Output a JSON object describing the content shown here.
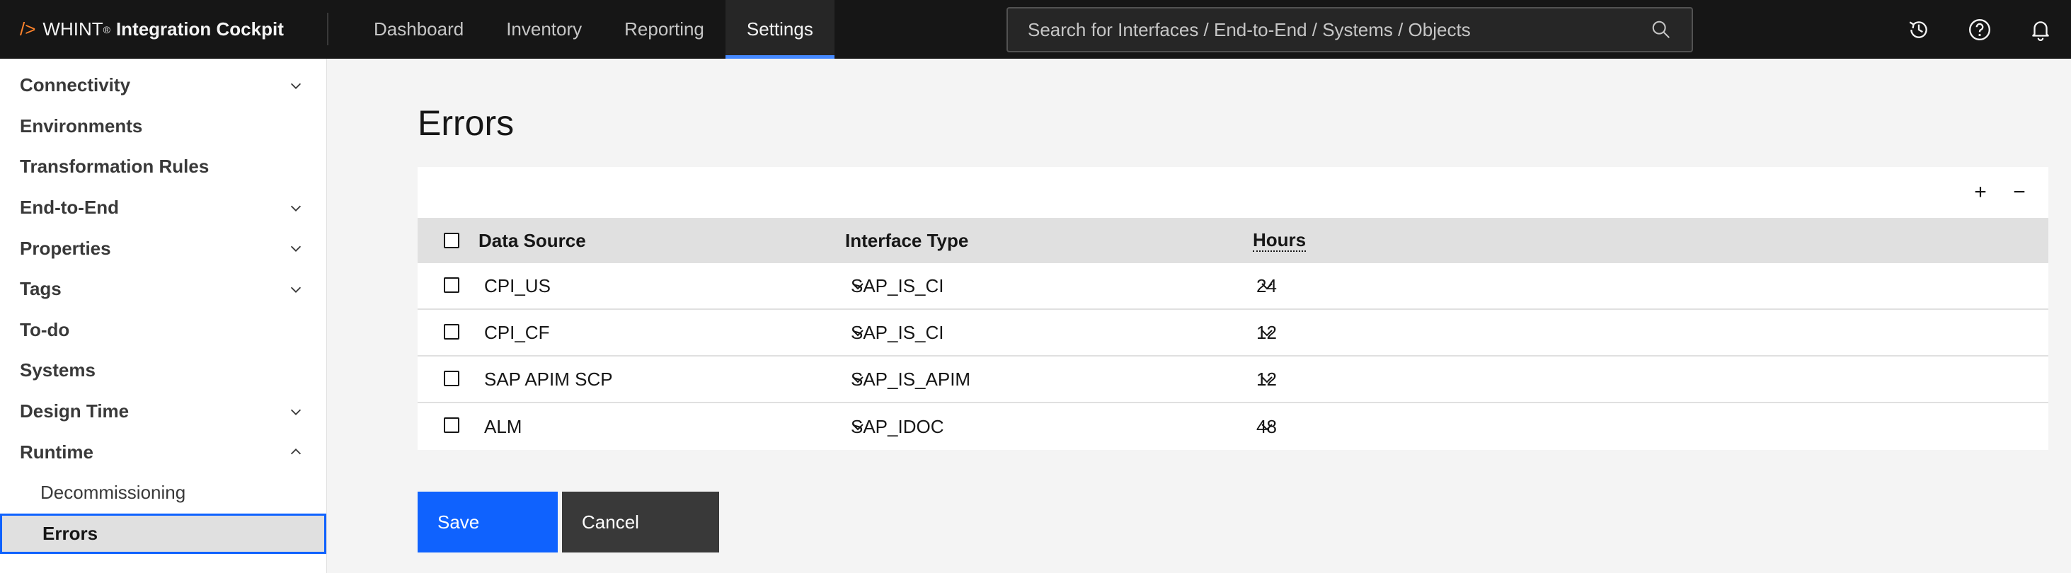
{
  "header": {
    "brand_slash": "/>",
    "brand_name": "WHINT",
    "brand_reg": "®",
    "brand_product": "Integration Cockpit",
    "nav": [
      {
        "label": "Dashboard"
      },
      {
        "label": "Inventory"
      },
      {
        "label": "Reporting"
      },
      {
        "label": "Settings"
      }
    ],
    "active_nav": "Settings",
    "search": {
      "placeholder": "Search for Interfaces / End-to-End / Systems / Objects",
      "value": ""
    },
    "icons": [
      "history-icon",
      "help-icon",
      "notification-icon"
    ]
  },
  "sidebar": {
    "items": [
      {
        "label": "Connectivity",
        "expandable": true,
        "expanded": false
      },
      {
        "label": "Environments",
        "expandable": false
      },
      {
        "label": "Transformation Rules",
        "expandable": false
      },
      {
        "label": "End-to-End",
        "expandable": true,
        "expanded": false
      },
      {
        "label": "Properties",
        "expandable": true,
        "expanded": false
      },
      {
        "label": "Tags",
        "expandable": true,
        "expanded": false
      },
      {
        "label": "To-do",
        "expandable": false
      },
      {
        "label": "Systems",
        "expandable": false
      },
      {
        "label": "Design Time",
        "expandable": true,
        "expanded": false
      },
      {
        "label": "Runtime",
        "expandable": true,
        "expanded": true
      }
    ],
    "sub_items": [
      {
        "label": "Decommissioning",
        "selected": false
      },
      {
        "label": "Errors",
        "selected": true
      }
    ]
  },
  "main": {
    "title": "Errors",
    "toolbar": {
      "add_label": "+",
      "remove_label": "−"
    },
    "table": {
      "columns": [
        "Data Source",
        "Interface Type",
        "Hours"
      ],
      "rows": [
        {
          "data_source": "CPI_US",
          "interface_type": "SAP_IS_CI",
          "hours": "24",
          "checked": false
        },
        {
          "data_source": "CPI_CF",
          "interface_type": "SAP_IS_CI",
          "hours": "12",
          "checked": false
        },
        {
          "data_source": "SAP APIM SCP",
          "interface_type": "SAP_IS_APIM",
          "hours": "12",
          "checked": false
        },
        {
          "data_source": "ALM",
          "interface_type": "SAP_IDOC",
          "hours": "48",
          "checked": false
        }
      ]
    },
    "buttons": {
      "save": "Save",
      "cancel": "Cancel"
    }
  },
  "colors": {
    "header_bg": "#161616",
    "accent": "#0f62fe",
    "nav_active_underline": "#4589ff",
    "brand_slash": "#ff832b",
    "cancel_bg": "#393939",
    "page_bg": "#f4f4f4"
  }
}
